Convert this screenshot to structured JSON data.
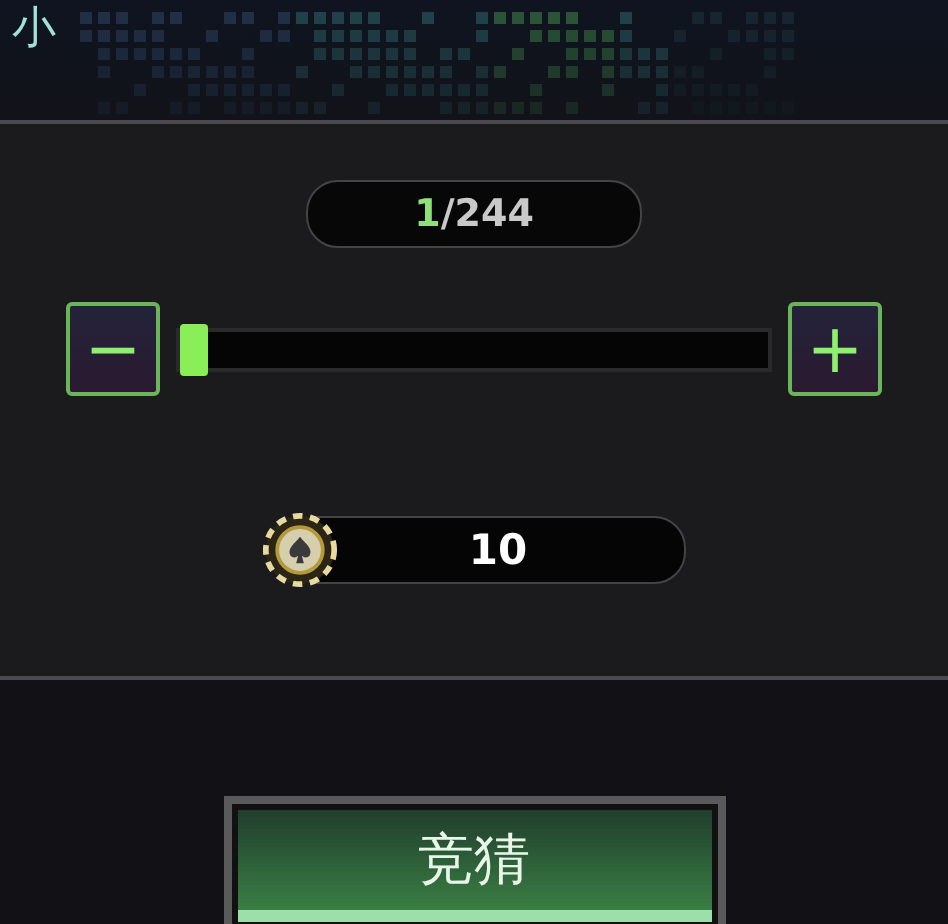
{
  "header": {
    "title": "小"
  },
  "counter": {
    "current": "1",
    "total": "/244"
  },
  "slider": {
    "level": 0,
    "decrease": "−",
    "increase": "+"
  },
  "bet": {
    "amount": "10"
  },
  "submit_button": {
    "label": "竞猜"
  }
}
